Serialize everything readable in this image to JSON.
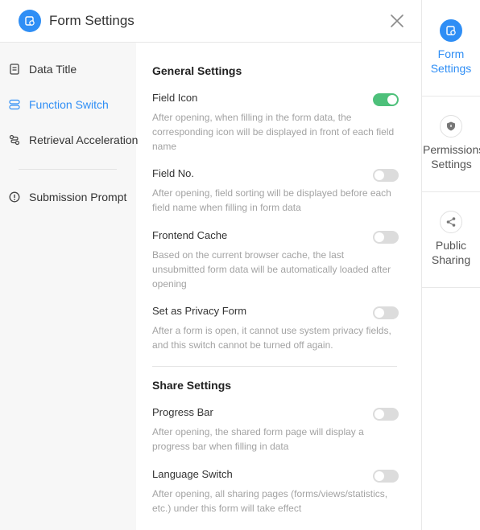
{
  "header": {
    "title": "Form Settings"
  },
  "nav": {
    "items": [
      {
        "label": "Data Title"
      },
      {
        "label": "Function Switch"
      },
      {
        "label": "Retrieval Acceleration"
      },
      {
        "label": "Submission Prompt"
      }
    ],
    "active_index": 1
  },
  "sections": {
    "general": {
      "title": "General Settings"
    },
    "share": {
      "title": "Share Settings"
    }
  },
  "settings": [
    {
      "name": "Field Icon",
      "desc": "After opening, when filling in the form data, the corresponding icon will be displayed in front of each field name",
      "on": true
    },
    {
      "name": "Field No.",
      "desc": "After opening, field sorting will be displayed before each field name when filling in form data",
      "on": false
    },
    {
      "name": "Frontend Cache",
      "desc": "Based on the current browser cache, the last unsubmitted form data will be automatically loaded after opening",
      "on": false
    },
    {
      "name": "Set as Privacy Form",
      "desc": "After a form is open, it cannot use system privacy fields, and this switch cannot be turned off again.",
      "on": false
    },
    {
      "name": "Progress Bar",
      "desc": "After opening, the shared form page will display a progress bar when filling in data",
      "on": false
    },
    {
      "name": "Language Switch",
      "desc": "After opening, all sharing pages (forms/views/statistics, etc.) under this form will take effect",
      "on": false
    }
  ],
  "right_tabs": [
    {
      "line1": "Form",
      "line2": "Settings",
      "icon": "form-settings-icon"
    },
    {
      "line1": "Permissions",
      "line2": "Settings",
      "icon": "shield-icon"
    },
    {
      "line1": "Public",
      "line2": "Sharing",
      "icon": "share-icon"
    }
  ],
  "colors": {
    "accent": "#2f8ef5",
    "toggle_on": "#4dc07a",
    "toggle_off": "#dcdcdc"
  }
}
